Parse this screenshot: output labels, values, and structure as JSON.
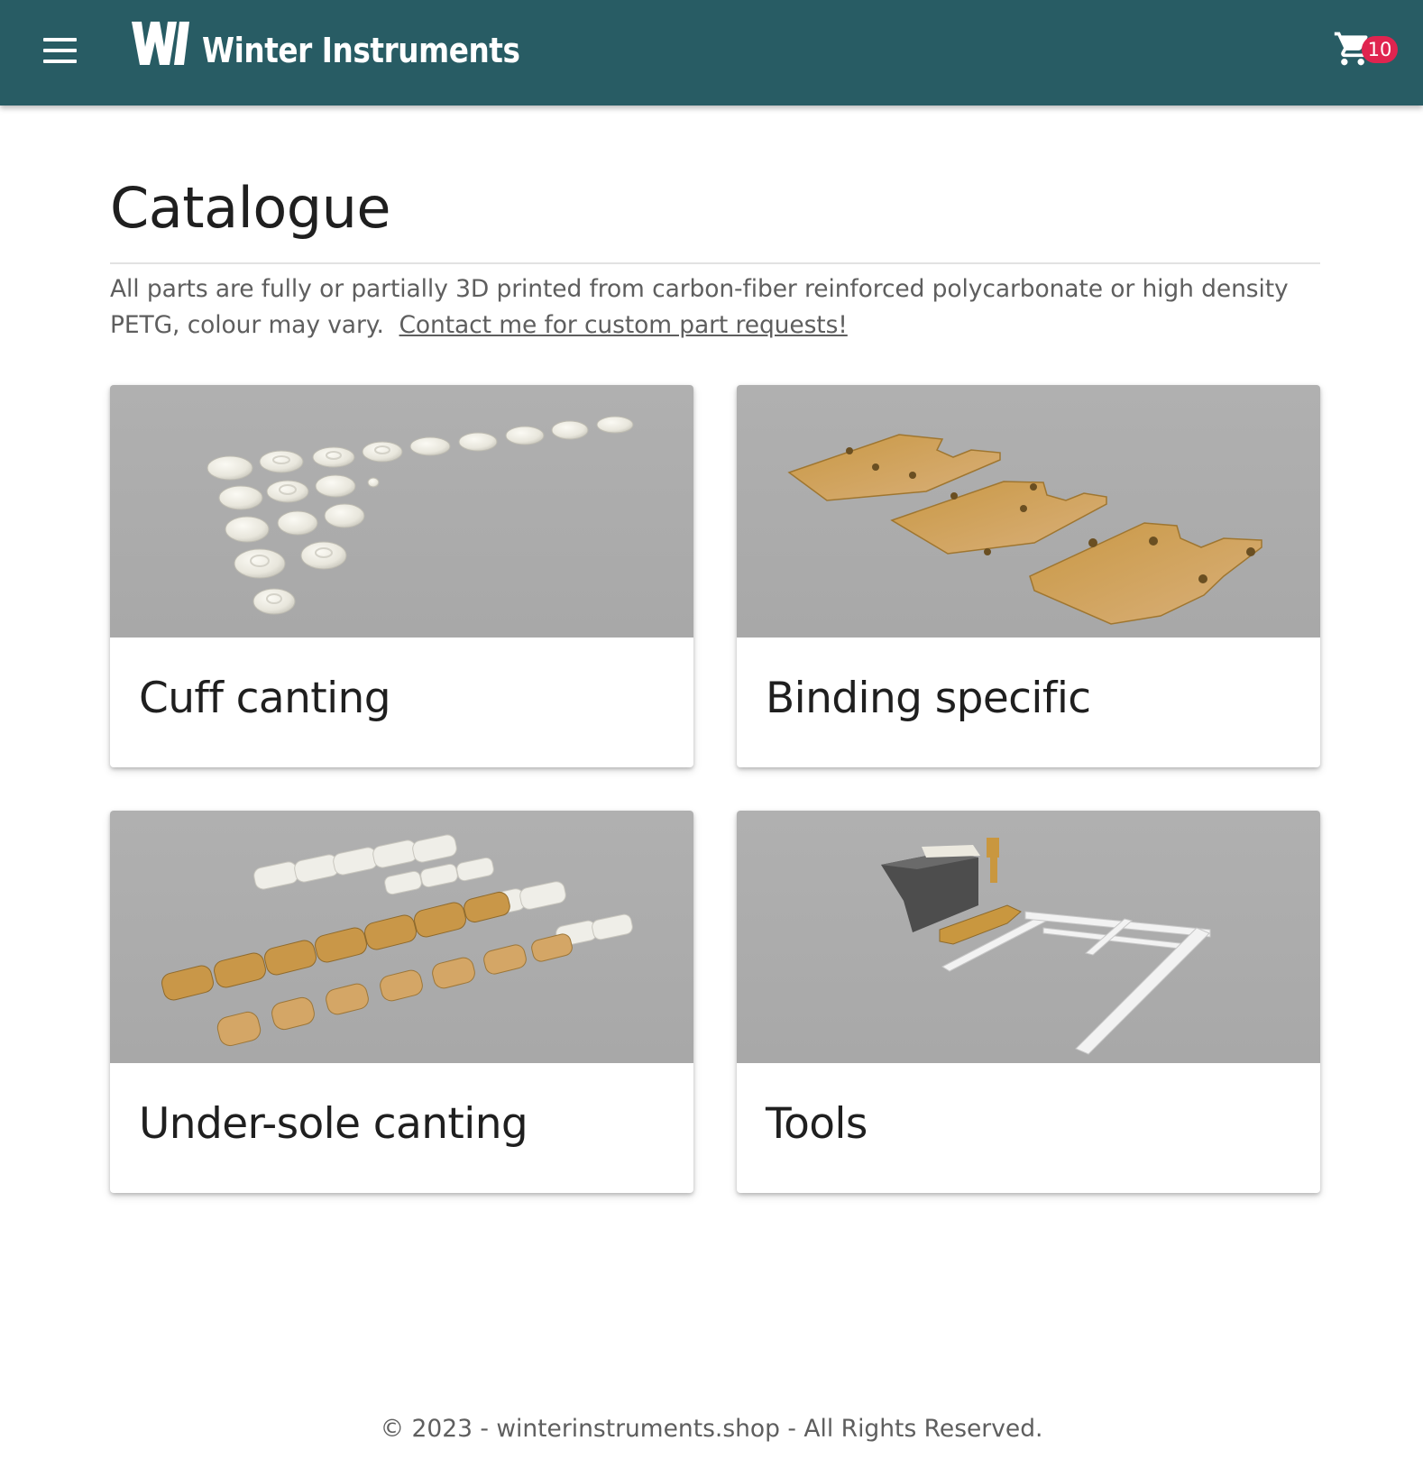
{
  "header": {
    "brand_name": "Winter Instruments",
    "logo_mark": "Wi",
    "menu_icon": "menu-icon",
    "cart_icon": "shopping-cart-icon",
    "cart_count": "10",
    "colors": {
      "app_bar": "#285c64",
      "badge": "#e0244f"
    }
  },
  "main": {
    "title": "Catalogue",
    "intro_text": "All parts are fully or partially 3D printed from carbon-fiber reinforced polycarbonate or high density PETG, colour may vary.",
    "contact_link": "Contact me for custom part requests!"
  },
  "categories": [
    {
      "title": "Cuff canting",
      "image": "white-3d-printed-cuff-parts"
    },
    {
      "title": "Binding specific",
      "image": "tan-3d-printed-binding-plates"
    },
    {
      "title": "Under-sole canting",
      "image": "white-and-tan-3d-printed-sole-shims"
    },
    {
      "title": "Tools",
      "image": "alignment-jig-tool"
    }
  ],
  "footer": {
    "text": "© 2023 - winterinstruments.shop - All Rights Reserved."
  }
}
